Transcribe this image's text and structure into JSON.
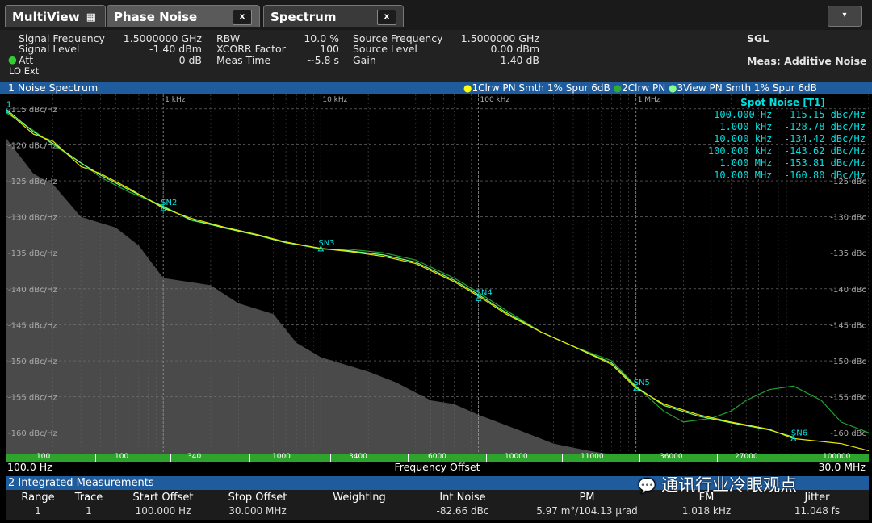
{
  "tabs": [
    {
      "label": "MultiView",
      "icon": "grid-icon"
    },
    {
      "label": "Phase Noise",
      "close": "x"
    },
    {
      "label": "Spectrum",
      "close": "x"
    }
  ],
  "menu_icon": "▾",
  "info": {
    "signal_frequency_label": "Signal Frequency",
    "signal_frequency": "1.5000000 GHz",
    "signal_level_label": "Signal Level",
    "signal_level": "-1.40 dBm",
    "att_label": "Att",
    "att": "0 dB",
    "lo_ext": "LO Ext",
    "rbw_label": "RBW",
    "rbw": "10.0 %",
    "xcorr_label": "XCORR Factor",
    "xcorr": "100",
    "meas_time_label": "Meas Time",
    "meas_time": "~5.8 s",
    "source_frequency_label": "Source Frequency",
    "source_frequency": "1.5000000 GHz",
    "source_level_label": "Source Level",
    "source_level": "0.00 dBm",
    "gain_label": "Gain",
    "gain": "-1.40 dB",
    "sgl": "SGL",
    "meas_mode": "Meas: Additive Noise"
  },
  "pane": {
    "title": "1 Noise Spectrum",
    "trace1": "1Clrw PN Smth 1% Spur 6dB",
    "trace2": "2Clrw PN",
    "trace3": "3View PN Smth 1% Spur 6dB"
  },
  "colors": {
    "trace1": "#e6e600",
    "trace2": "#20a030",
    "trace3": "#80ff80",
    "marker": "#00e0e0",
    "title_bar": "#1f5c9e",
    "xbar": "#2da52d"
  },
  "chart_data": {
    "type": "line",
    "x_scale": "log",
    "xlim": [
      100,
      30000000
    ],
    "ylim": [
      -163,
      -113
    ],
    "x_ticks": [
      {
        "value": 1000,
        "label": "1 kHz"
      },
      {
        "value": 10000,
        "label": "10 kHz"
      },
      {
        "value": 100000,
        "label": "100 kHz"
      },
      {
        "value": 1000000,
        "label": "1 MHz"
      }
    ],
    "y_ticks": [
      {
        "value": -115,
        "label": "-115 dBc/Hz"
      },
      {
        "value": -120,
        "label": "-120 dBc/Hz"
      },
      {
        "value": -125,
        "label": "-125 dBc/Hz"
      },
      {
        "value": -130,
        "label": "-130 dBc/Hz"
      },
      {
        "value": -135,
        "label": "-135 dBc/Hz"
      },
      {
        "value": -140,
        "label": "-140 dBc/Hz"
      },
      {
        "value": -145,
        "label": "-145 dBc/Hz"
      },
      {
        "value": -150,
        "label": "-150 dBc/Hz"
      },
      {
        "value": -155,
        "label": "-155 dBc/Hz"
      },
      {
        "value": -160,
        "label": "-160 dBc/Hz"
      }
    ],
    "right_y_labels": [
      {
        "value": -125,
        "label": "-125 dBc"
      },
      {
        "value": -130,
        "label": "-130 dBc"
      },
      {
        "value": -135,
        "label": "-135 dBc"
      },
      {
        "value": -140,
        "label": "-140 dBc"
      },
      {
        "value": -145,
        "label": "-145 dBc"
      },
      {
        "value": -150,
        "label": "-150 dBc"
      },
      {
        "value": -155,
        "label": "-155 dBc"
      },
      {
        "value": -160,
        "label": "-160 dBc"
      }
    ],
    "series": [
      {
        "name": "1Clrw PN Smth 1% Spur 6dB",
        "x": [
          100,
          150,
          200,
          300,
          400,
          600,
          1000,
          1500,
          2500,
          4000,
          6000,
          10000,
          15000,
          25000,
          40000,
          70000,
          100000,
          150000,
          250000,
          400000,
          700000,
          1000000,
          1500000,
          2500000,
          4000000,
          7000000,
          10000000,
          20000000,
          30000000
        ],
        "y": [
          -115.2,
          -118.5,
          -119.5,
          -123,
          -124,
          -126,
          -128.8,
          -130.2,
          -131.5,
          -132.5,
          -133.5,
          -134.4,
          -134.8,
          -135.5,
          -136.5,
          -139,
          -141,
          -143.5,
          -146,
          -148,
          -150.5,
          -153.8,
          -156,
          -157.5,
          -158.5,
          -159.5,
          -160.8,
          -161.5,
          -162.5
        ]
      },
      {
        "name": "2Clrw PN",
        "x": [
          100,
          150,
          200,
          300,
          400,
          600,
          1000,
          1500,
          2500,
          4000,
          6000,
          10000,
          15000,
          25000,
          40000,
          70000,
          100000,
          150000,
          250000,
          400000,
          700000,
          1000000,
          1500000,
          2000000,
          3000000,
          4000000,
          5000000,
          7000000,
          10000000,
          15000000,
          20000000,
          30000000
        ],
        "y": [
          -115.5,
          -118,
          -120,
          -122.5,
          -124.5,
          -126.5,
          -128.5,
          -130.5,
          -131.5,
          -132.5,
          -133.5,
          -134.5,
          -134.5,
          -135,
          -136,
          -138.5,
          -140.5,
          -143,
          -146,
          -148,
          -150,
          -153.5,
          -157,
          -158.5,
          -158,
          -157,
          -155.5,
          -154,
          -153.5,
          -155.5,
          -158.5,
          -160
        ]
      },
      {
        "name": "3View PN Smth 1% Spur 6dB",
        "x": [
          100,
          150,
          200,
          300,
          400,
          600,
          1000,
          1500,
          2500,
          4000,
          6000,
          10000,
          15000,
          25000,
          40000,
          70000,
          100000,
          150000,
          250000,
          400000,
          700000,
          1000000,
          1500000,
          2500000,
          4000000,
          7000000,
          10000000
        ],
        "y": [
          -115,
          -118.2,
          -119.8,
          -122.5,
          -124.2,
          -126.2,
          -128.6,
          -130.4,
          -131.6,
          -132.6,
          -133.6,
          -134.4,
          -134.7,
          -135.3,
          -136.3,
          -138.8,
          -140.8,
          -143.3,
          -146,
          -148,
          -150.3,
          -153.6,
          -156.2,
          -157.7,
          -158.6,
          -159.6,
          -160.6
        ]
      },
      {
        "name": "Noise floor",
        "role": "floor",
        "x": [
          100,
          150,
          200,
          300,
          500,
          700,
          1000,
          2000,
          3000,
          5000,
          7000,
          10000,
          20000,
          30000,
          50000,
          70000,
          100000,
          200000,
          300000,
          500000,
          700000,
          1000000
        ],
        "y": [
          -119,
          -124,
          -125.5,
          -130,
          -131.5,
          -134,
          -138.5,
          -139.5,
          -142,
          -143.5,
          -147.5,
          -149.5,
          -151.5,
          -153,
          -155.5,
          -156,
          -157.5,
          -160,
          -161.5,
          -162.5,
          -163,
          -163
        ]
      }
    ],
    "spot_noise": {
      "title": "Spot Noise [T1]",
      "rows": [
        {
          "offset": "100.000 Hz",
          "value": "-115.15 dBc/Hz"
        },
        {
          "offset": "1.000 kHz",
          "value": "-128.78 dBc/Hz"
        },
        {
          "offset": "10.000 kHz",
          "value": "-134.42 dBc/Hz"
        },
        {
          "offset": "100.000 kHz",
          "value": "-143.62 dBc/Hz"
        },
        {
          "offset": "1.000 MHz",
          "value": "-153.81 dBc/Hz"
        },
        {
          "offset": "10.000 MHz",
          "value": "-160.80 dBc/Hz"
        }
      ]
    },
    "markers": [
      {
        "label": "1",
        "x": 100,
        "y": -115.2
      },
      {
        "label": "SN2",
        "x": 1000,
        "y": -128.8
      },
      {
        "label": "SN3",
        "x": 10000,
        "y": -134.4
      },
      {
        "label": "SN4",
        "x": 100000,
        "y": -141.3
      },
      {
        "label": "SN5",
        "x": 1000000,
        "y": -153.8
      },
      {
        "label": "SN6",
        "x": 10000000,
        "y": -160.8
      }
    ],
    "bar_values": [
      "100",
      "100",
      "340",
      "1000",
      "3400",
      "6000",
      "10000",
      "11000",
      "36000",
      "27000",
      "100000"
    ],
    "start_label": "100.0 Hz",
    "stop_label": "30.0 MHz",
    "xlabel": "Frequency Offset"
  },
  "measurements": {
    "title": "2 Integrated Measurements",
    "headers": [
      "Range",
      "Trace",
      "Start Offset",
      "Stop Offset",
      "Weighting",
      "Int Noise",
      "PM",
      "FM",
      "Jitter"
    ],
    "row": [
      "1",
      "1",
      "100.000 Hz",
      "30.000 MHz",
      "",
      "-82.66 dBc",
      "5.97 m°/104.13 µrad",
      "1.018 kHz",
      "11.048 fs"
    ]
  },
  "watermark": "通讯行业冷眼观点"
}
